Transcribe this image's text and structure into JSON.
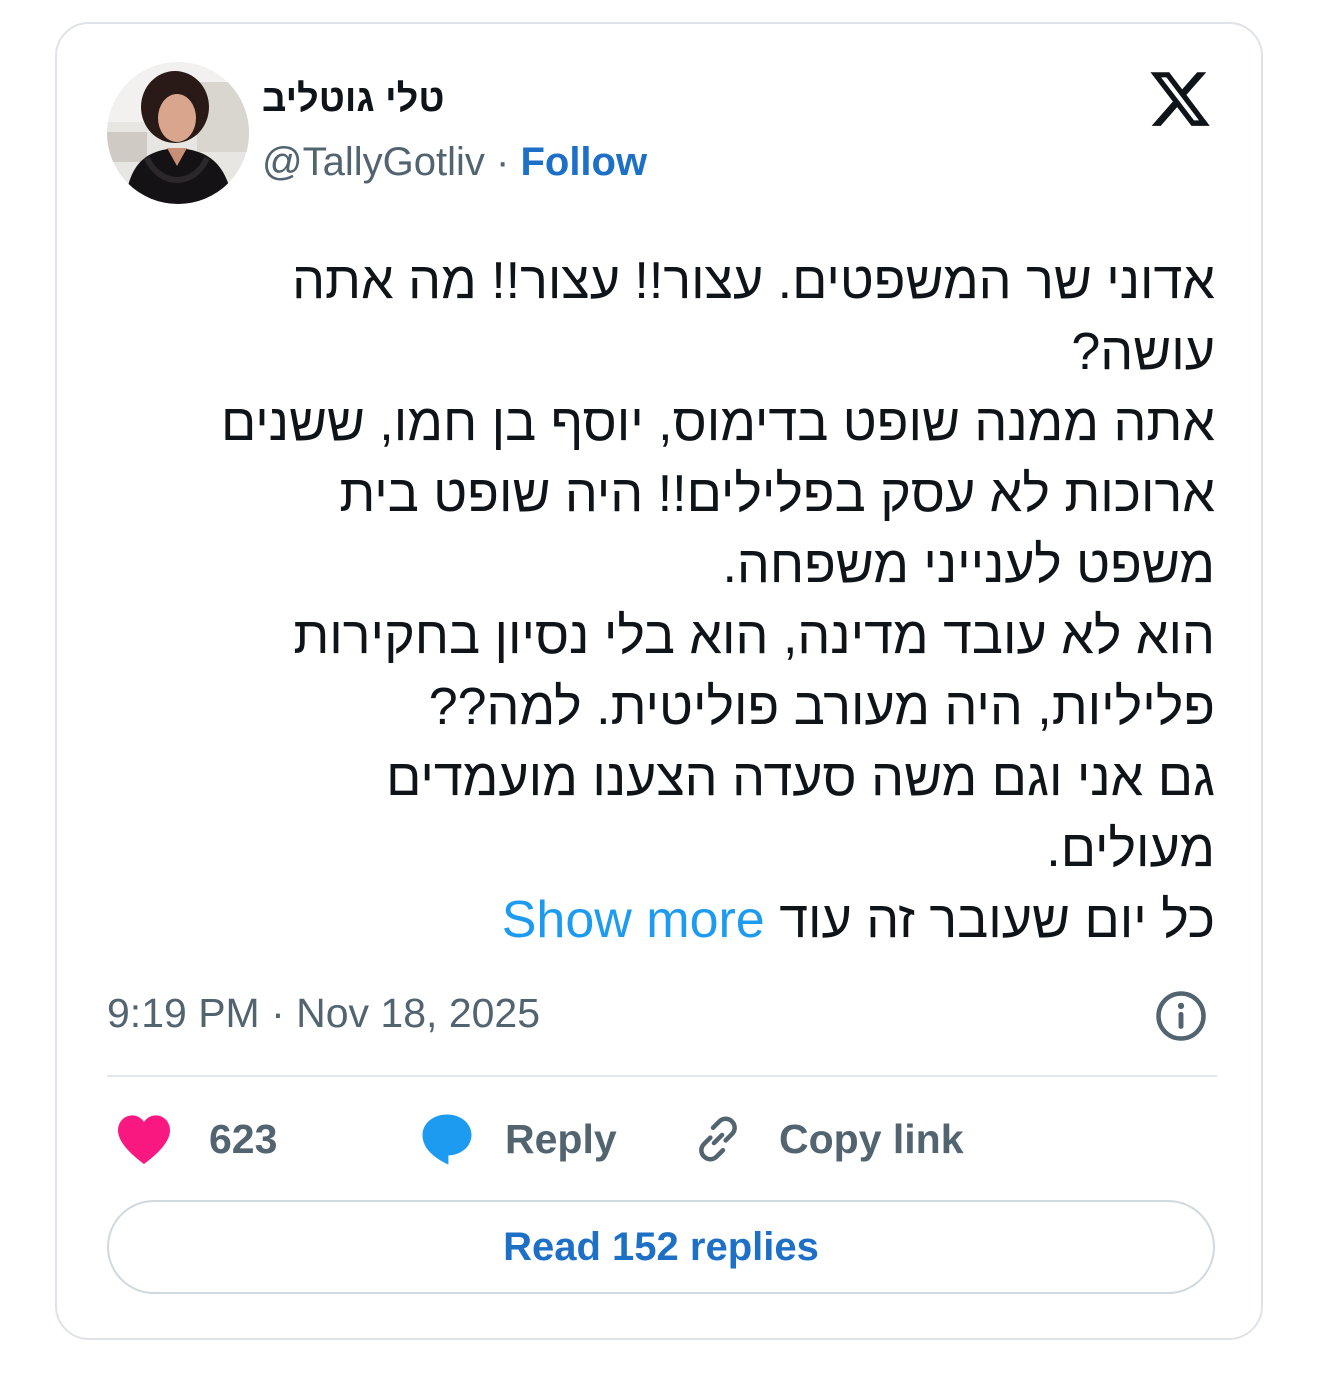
{
  "author": {
    "display_name": "טלי גוטליב",
    "handle": "@TallyGotliv",
    "separator": "·",
    "follow_label": "Follow"
  },
  "tweet": {
    "lines": [
      "אדוני שר המשפטים. עצור!! עצור!! מה אתה",
      "עושה?",
      "אתה ממנה שופט בדימוס, יוסף בן חמו, ששנים",
      "ארוכות לא עסק בפלילים!! היה שופט בית",
      "משפט לענייני משפחה.",
      "הוא לא עובד מדינה, הוא בלי נסיון בחקירות",
      "פליליות, היה מעורב פוליטית. למה??",
      "גם אני וגם משה סעדה הצענו מועמדים",
      "מעולים."
    ],
    "last_line": "כל יום שעובר זה עוד",
    "show_more_label": "Show more",
    "timestamp": "9:19 PM · Nov 18, 2025"
  },
  "actions": {
    "likes_count": "623",
    "reply_label": "Reply",
    "copy_link_label": "Copy link"
  },
  "read_replies_label": "Read 152 replies",
  "icons": {
    "like": "heart-icon",
    "reply": "speech-bubble-icon",
    "copy": "link-icon",
    "info": "info-icon",
    "brand": "x-logo-icon"
  },
  "colors": {
    "like": "#f91880",
    "reply": "#1d9bf0",
    "link": "#1d70c6",
    "show_more": "#1d9bf0",
    "muted": "#536471"
  }
}
